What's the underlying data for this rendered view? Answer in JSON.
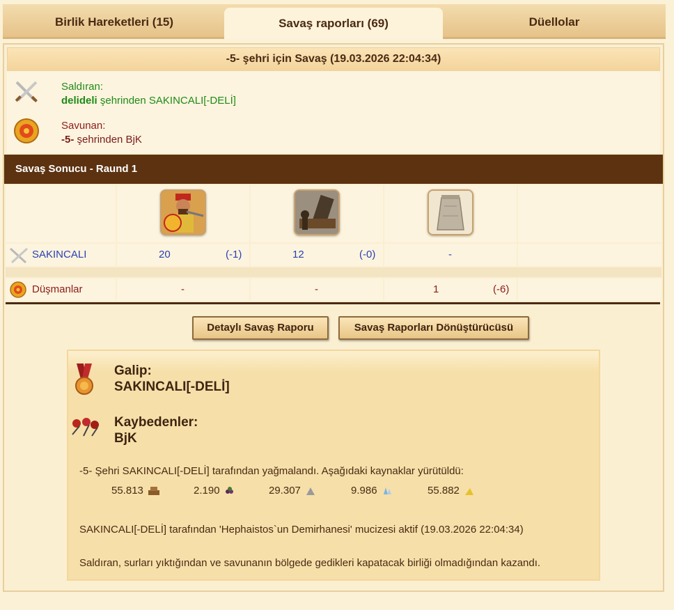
{
  "tabs": [
    {
      "label": "Birlik Hareketleri (15)"
    },
    {
      "label": "Savaş raporları (69)"
    },
    {
      "label": "Düellolar"
    }
  ],
  "report": {
    "title": "-5- şehri için Savaş (19.03.2026 22:04:34)",
    "attacker": {
      "label": "Saldıran:",
      "city": "delideli",
      "from_text": " şehrinden SAKINCALI[-DELİ]"
    },
    "defender": {
      "label": "Savunan:",
      "city": "-5-",
      "from_text": " şehrinden BjK"
    },
    "result_title": "Savaş Sonucu - Raund 1",
    "rows": [
      {
        "name": "SAKINCALI",
        "units": [
          {
            "count": "20",
            "loss": "(-1)"
          },
          {
            "count": "12",
            "loss": "(-0)"
          },
          {
            "count": "-",
            "loss": ""
          }
        ]
      },
      {
        "name": "Düşmanlar",
        "units": [
          {
            "count": "-",
            "loss": ""
          },
          {
            "count": "-",
            "loss": ""
          },
          {
            "count": "1",
            "loss": "(-6)"
          }
        ]
      }
    ],
    "unit_icons": [
      "hoplite-unit-icon",
      "catapult-unit-icon",
      "wall-icon"
    ]
  },
  "buttons": {
    "detailed": "Detaylı Savaş Raporu",
    "converter": "Savaş Raporları Dönüştürücüsü"
  },
  "summary": {
    "winner_label": "Galip:",
    "winner": "SAKINCALI[-DELİ]",
    "losers_label": "Kaybedenler:",
    "losers": "BjK",
    "plunder_text": "-5- Şehri SAKINCALI[-DELİ] tarafından yağmalandı. Aşağıdaki kaynaklar yürütüldü:",
    "resources": [
      {
        "value": "55.813",
        "icon": "wood-icon"
      },
      {
        "value": "2.190",
        "icon": "wine-icon"
      },
      {
        "value": "29.307",
        "icon": "marble-icon"
      },
      {
        "value": "9.986",
        "icon": "crystal-icon"
      },
      {
        "value": "55.882",
        "icon": "sulfur-icon"
      }
    ],
    "wonder_text": "SAKINCALI[-DELİ] tarafından 'Hephaistos`un Demirhanesi' mucizesi aktif (19.03.2026 22:04:34)",
    "reason_text": "Saldıran, surları yıktığından ve savunanın bölgede gedikleri kapatacak birliği olmadığından kazandı."
  }
}
